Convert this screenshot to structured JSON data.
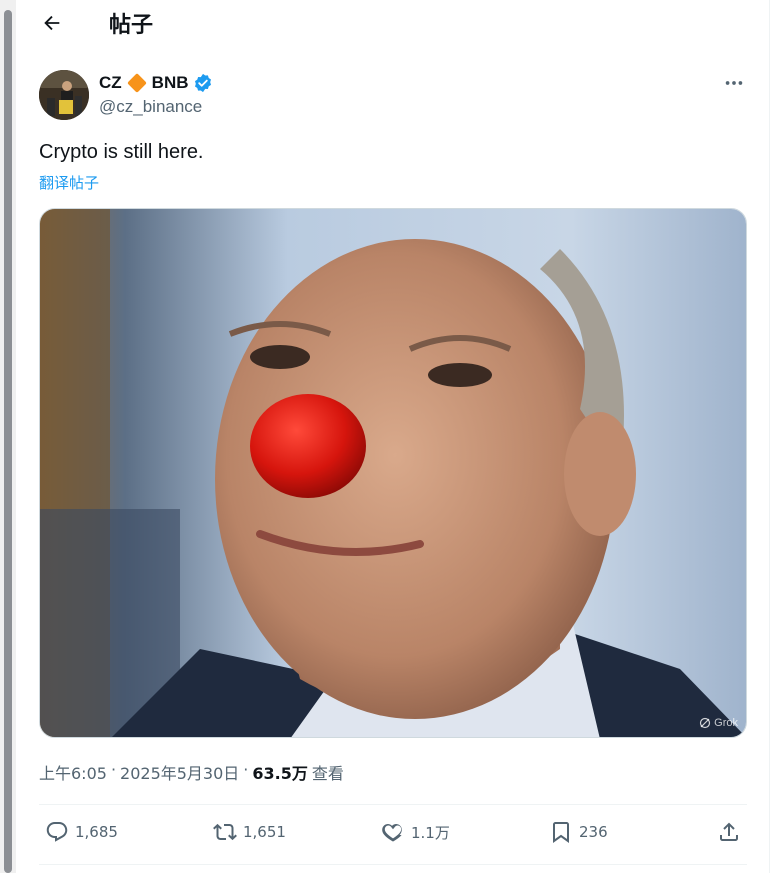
{
  "header": {
    "title": "帖子"
  },
  "author": {
    "name": "CZ",
    "badge_name": "BNB",
    "handle": "@cz_binance"
  },
  "tweet": {
    "text": "Crypto is still here.",
    "translate_label": "翻译帖子",
    "media_watermark": "Grok"
  },
  "meta": {
    "time": "上午6:05",
    "sep1": "·",
    "date": "2025年5月30日",
    "sep2": "·",
    "views_count": "63.5万",
    "views_label": "查看"
  },
  "actions": {
    "replies": "1,685",
    "reposts": "1,651",
    "likes": "1.1万",
    "bookmarks": "236"
  },
  "colors": {
    "accent": "#1d9bf0",
    "secondary_text": "#536471",
    "verified": "#1d9bf0",
    "bnb_diamond": "#f7931a"
  }
}
